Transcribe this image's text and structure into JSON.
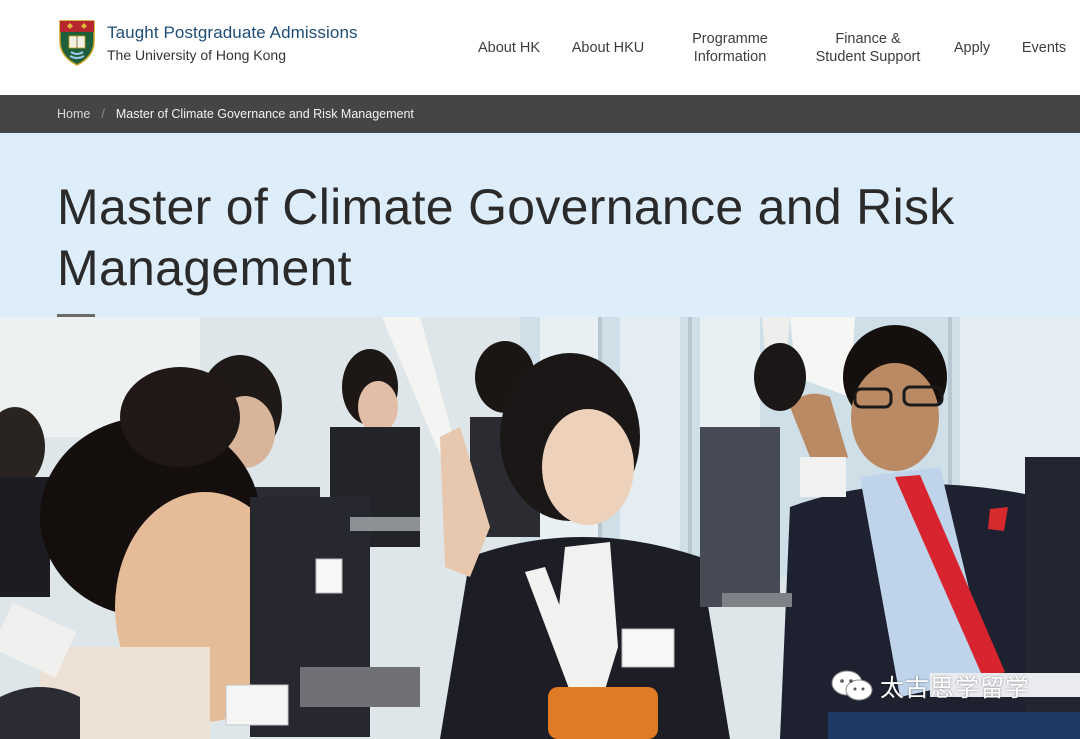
{
  "header": {
    "logo_title": "Taught Postgraduate Admissions",
    "logo_subtitle": "The University of Hong Kong",
    "nav": [
      {
        "label": "About HK"
      },
      {
        "label": "About HKU"
      },
      {
        "label": "Programme\nInformation"
      },
      {
        "label": "Finance &\nStudent Support"
      },
      {
        "label": "Apply"
      },
      {
        "label": "Events"
      }
    ]
  },
  "breadcrumb": {
    "home": "Home",
    "separator": "/",
    "current": "Master of Climate Governance and Risk Management"
  },
  "page": {
    "title": "Master of Climate Governance and Risk Management"
  },
  "hero": {
    "icon": "classroom-photo"
  },
  "watermark": {
    "icon": "wechat-icon",
    "text": "太古思学留学"
  },
  "colors": {
    "logo_blue": "#1f4d7a",
    "breadcrumb_bg": "#454545",
    "title_band_bg": "#deedfa",
    "watermark_bar": "#1f3a64"
  }
}
